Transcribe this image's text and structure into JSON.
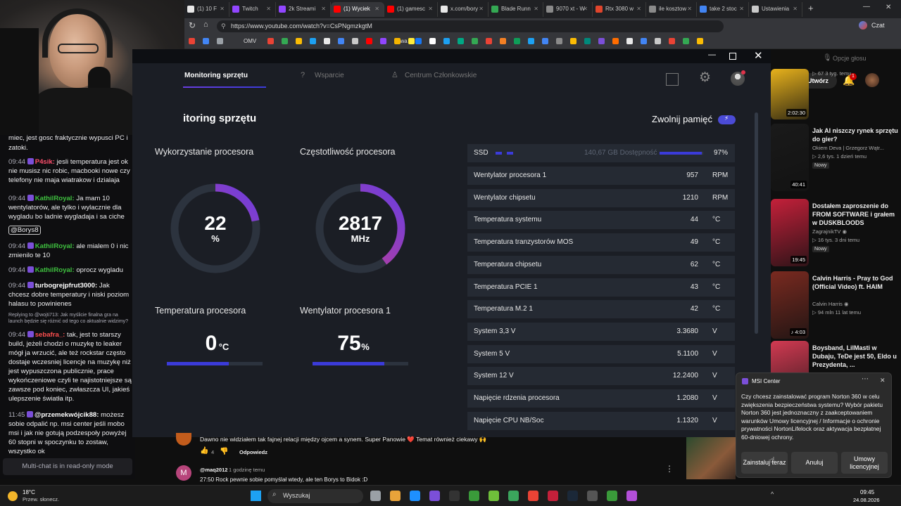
{
  "browser": {
    "tabs": [
      {
        "label": "(1) 10 F",
        "color": "#e8e8e8"
      },
      {
        "label": "Twitch",
        "color": "#9146ff"
      },
      {
        "label": "2k Streami",
        "color": "#9146ff"
      },
      {
        "label": "(1) Wyciek",
        "color": "#ff0000"
      },
      {
        "label": "(1) gamesc",
        "color": "#ff0000"
      },
      {
        "label": "x.com/bory",
        "color": "#e8e8e8"
      },
      {
        "label": "Blade Runn",
        "color": "#34a853"
      },
      {
        "label": "9070 xt - W",
        "color": "#8a8a8a"
      },
      {
        "label": "Rtx 3080 w",
        "color": "#e0452c"
      },
      {
        "label": "ile kosztow",
        "color": "#8a8a8a"
      },
      {
        "label": "take 2 stoc",
        "color": "#4285f4"
      },
      {
        "label": "Ustawienia",
        "color": "#c9c9c9"
      }
    ],
    "new_tab": "+",
    "url": "https://www.youtube.com/watch?v=CsPNgmzkgtM",
    "chat_label": "Czat",
    "bookmark_label_omv": "OMV",
    "bookmark_label_kawa": "kawa"
  },
  "chat": {
    "messages": [
      {
        "text": "miec, jest gosc fraktycznie wypusci PC i"
      },
      {
        "text": "zatoki."
      },
      {
        "time": "09:44",
        "user": "P4sik:",
        "ucolor": "#ff4f6d",
        "text": "jesli temperatura jest ok nie musisz nic robic, macbooki nowe czy telefony nie maja wiatrakow i dzialaja"
      },
      {
        "time": "09:44",
        "user": "KathilRoyal:",
        "ucolor": "#3fc13f",
        "text": "Ja mam 10 wentylatorów, ale tylko i wylacznie dla wygladu bo ladnie wygladaja i sa ciche"
      },
      {
        "mention": "@Borys8"
      },
      {
        "time": "09:44",
        "user": "KathilRoyal:",
        "ucolor": "#3fc13f",
        "text": "ale mialem 0 i nic zmienilo te 10"
      },
      {
        "time": "09:44",
        "user": "KathilRoyal:",
        "ucolor": "#3fc13f",
        "text": "oprocz wygladu"
      },
      {
        "time": "09:44",
        "user": "turbogrejpfrut3000:",
        "ucolor": "#ffffff",
        "text": "Jak chcesz dobre temperatury i niski poziom halasu to powinienes"
      },
      {
        "reply": "Replying to @wojti713: Jak myślicie finalna gra na launch będzie się różnić od tego co aktualnie widzimy?"
      },
      {
        "time": "09:44",
        "user": "sebafra_:",
        "ucolor": "#ff4f4f",
        "text": "tak, jest to starszy build, jeżeli chodzi o muzykę to leaker mógł ja wrzucić, ale też rockstar często dostaje wczesniej licencje na muzykę niż jest wypuszczona publicznie, prace wykończeniowe czyli te najistotniejsze są zawsze pod koniec, zwłaszcza UI, jakieś ulepszenie światła itp."
      },
      {
        "time": "11:45",
        "user": "@przemekwójcik88:",
        "ucolor": "#ffffff",
        "text": "możesz sobie odpalić np. msi center jeśli mobo msi i jak nie gotują podzespoły powyżej 60 stopni w spoczynku to zostaw, wszystko ok"
      }
    ],
    "footer": "Multi-chat is in read-only mode"
  },
  "msi": {
    "nav": {
      "monitoring": "Monitoring sprzętu",
      "support": "Wsparcie",
      "members": "Centrum Członkowskie"
    },
    "page_title": "itoring sprzętu",
    "free_memory": "Zwolnij pamięć",
    "gauges": [
      {
        "label": "Wykorzystanie procesora",
        "value": "22",
        "unit": "%",
        "fraction": 0.22
      },
      {
        "label": "Częstotliwość procesora",
        "value": "2817",
        "unit": "MHz",
        "fraction": 0.4
      }
    ],
    "bars": [
      {
        "label": "Temperatura procesora",
        "value": "0",
        "unit": "°C",
        "fraction": 0.65
      },
      {
        "label": "Wentylator procesora 1",
        "value": "75",
        "unit": "%",
        "fraction": 0.75
      }
    ],
    "ssd": {
      "label": "SSD",
      "avail": "140,67 GB Dostępność",
      "percent": "97%",
      "fraction": 0.97
    },
    "sensors": [
      {
        "name": "Wentylator procesora 1",
        "value": "957",
        "unit": "RPM"
      },
      {
        "name": "Wentylator chipsetu",
        "value": "1210",
        "unit": "RPM"
      },
      {
        "name": "Temperatura systemu",
        "value": "44",
        "unit": "°C"
      },
      {
        "name": "Temperatura tranzystorów MOS",
        "value": "49",
        "unit": "°C"
      },
      {
        "name": "Temperatura chipsetu",
        "value": "62",
        "unit": "°C"
      },
      {
        "name": "Temperatura PCIE 1",
        "value": "43",
        "unit": "°C"
      },
      {
        "name": "Temperatura M.2 1",
        "value": "42",
        "unit": "°C"
      },
      {
        "name": "System 3,3 V",
        "value": "3.3680",
        "unit": "V"
      },
      {
        "name": "System 5 V",
        "value": "5.1100",
        "unit": "V"
      },
      {
        "name": "System 12 V",
        "value": "12.2400",
        "unit": "V"
      },
      {
        "name": "Napięcie rdzenia procesora",
        "value": "1.2080",
        "unit": "V"
      },
      {
        "name": "Napięcie CPU NB/Soc",
        "value": "1.1320",
        "unit": "V"
      }
    ]
  },
  "youtube": {
    "voice_options": "Opcje głosu",
    "create": "Utwórz",
    "notif_count": "1",
    "videos": [
      {
        "title": "",
        "channel": "",
        "meta": "▷ 67  3 tyg. temu",
        "duration": "2:02:30",
        "thumb": "#e8b21c"
      },
      {
        "title": "Jak AI niszczy rynek sprzętu do gier?",
        "channel": "Okiem Deva | Grzegorz Wątr...",
        "meta": "▷ 2,6 tys.  1 dzień temu",
        "badge": "Nowy",
        "duration": "40:41",
        "thumb": "#1a1a1a"
      },
      {
        "title": "Dostałem zaproszenie do FROM SOFTWARE i grałem w DUSKBLOODS",
        "channel": "ZagrajnikTV ◉",
        "meta": "▷ 16 tys.  3 dni temu",
        "badge": "Nowy",
        "duration": "19:45",
        "thumb": "#c4203a"
      },
      {
        "title": "Calvin Harris - Pray to God (Official Video) ft. HAIM",
        "channel": "Calvin Harris ◉",
        "meta": "▷ 94 mln  11 lat temu",
        "duration": "♪ 4:03",
        "thumb": "#7a2a20"
      },
      {
        "title": "Boysband, LilMasti w Dubaju, TeDe jest 50, Eldo u Prezydenta, ...",
        "channel": "",
        "meta": "",
        "duration": "",
        "thumb": "#d23a52"
      }
    ],
    "comment1": "Dawno nie widziałem tak fajnej relacji między ojcem a synem. Super Panowie ❤️ Temat również ciekawy 🙌",
    "likes": "4",
    "reply": "Odpowiedz",
    "comment2_user": "@maq2012",
    "comment2_time": "1 godzinę temu",
    "comment2_text": "27:50 Rock pewnie sobie pomyślał wtedy, ale ten Borys to Bidok :D"
  },
  "notification": {
    "app": "MSI Center",
    "body": "Czy chcesz zainstalować program Norton 360 w celu zwiększenia bezpieczeństwa systemu? Wybór pakietu Norton 360 jest jednoznaczny z zaakceptowaniem warunków Umowy licencyjnej / Informacje o ochronie prywatności NortonLifelock oraz aktywacja bezpłatnej 60-dniowej ochrony.",
    "install": "Zainstaluj teraz",
    "cancel": "Anuluj",
    "license": "Umowy licencyjnej"
  },
  "taskbar": {
    "weather_temp": "18°C",
    "weather_desc": "Przew. słonecz.",
    "search": "Wyszukaj",
    "time": "09:45",
    "date": "24.08.2026"
  },
  "colors": {
    "accent": "#4b4bd6",
    "gauge_from": "#d13f86",
    "gauge_to": "#6a3ee0",
    "panel": "#1b1e25",
    "row": "#252a33"
  }
}
